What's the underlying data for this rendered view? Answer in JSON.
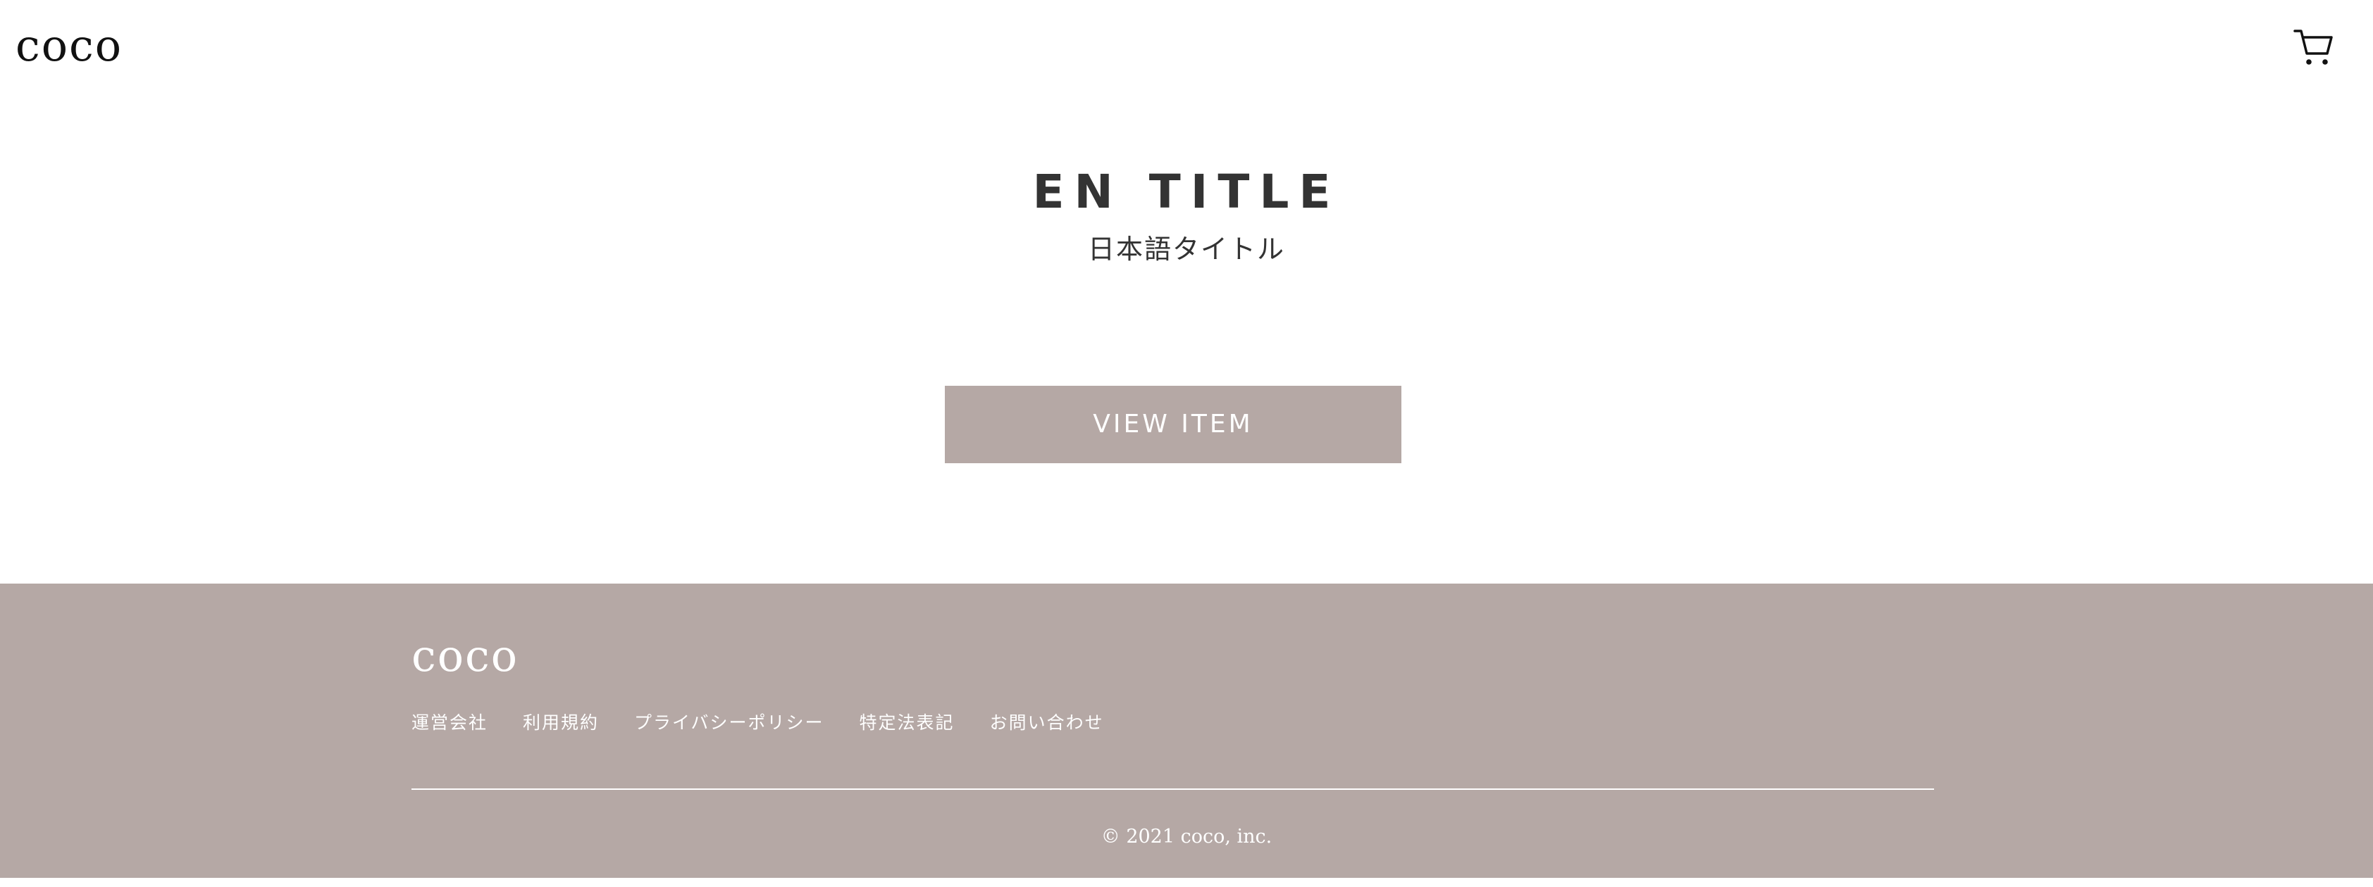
{
  "header": {
    "logo": "coco",
    "cart_icon": "shopping-cart-icon"
  },
  "hero": {
    "title": "EN TITLE",
    "subtitle": "日本語タイトル",
    "button_label": "VIEW ITEM"
  },
  "footer": {
    "logo": "coco",
    "links": [
      {
        "label": "運営会社"
      },
      {
        "label": "利用規約"
      },
      {
        "label": "プライバシーポリシー"
      },
      {
        "label": "特定法表記"
      },
      {
        "label": "お問い合わせ"
      }
    ],
    "copyright": "© 2021 coco, inc."
  },
  "colors": {
    "accent": "#b5a8a5",
    "text": "#333333",
    "background": "#ffffff"
  }
}
